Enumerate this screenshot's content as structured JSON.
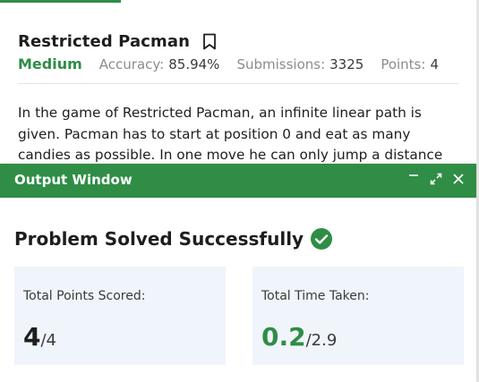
{
  "problem": {
    "title": "Restricted Pacman",
    "difficulty": "Medium",
    "accuracy_label": "Accuracy:",
    "accuracy": "85.94%",
    "submissions_label": "Submissions:",
    "submissions": "3325",
    "points_label": "Points:",
    "points": "4",
    "statement_lines": [
      "In the game of Restricted Pacman, an infinite linear path is",
      "given. Pacman has to start at position 0 and eat as many",
      "candies as possible. In one move he can only jump a distance"
    ]
  },
  "output_window": {
    "title": "Output Window",
    "status": "Problem Solved Successfully",
    "points_card": {
      "label": "Total Points Scored:",
      "value": "4",
      "total": "/4"
    },
    "time_card": {
      "label": "Total Time Taken:",
      "value": "0.2",
      "total": "/2.9"
    }
  },
  "colors": {
    "accent_green": "#2f8d46",
    "card_bg": "#f0f4fb"
  },
  "icons": [
    "bookmark-icon",
    "minimize-icon",
    "expand-icon",
    "close-icon",
    "check-circle-icon"
  ]
}
